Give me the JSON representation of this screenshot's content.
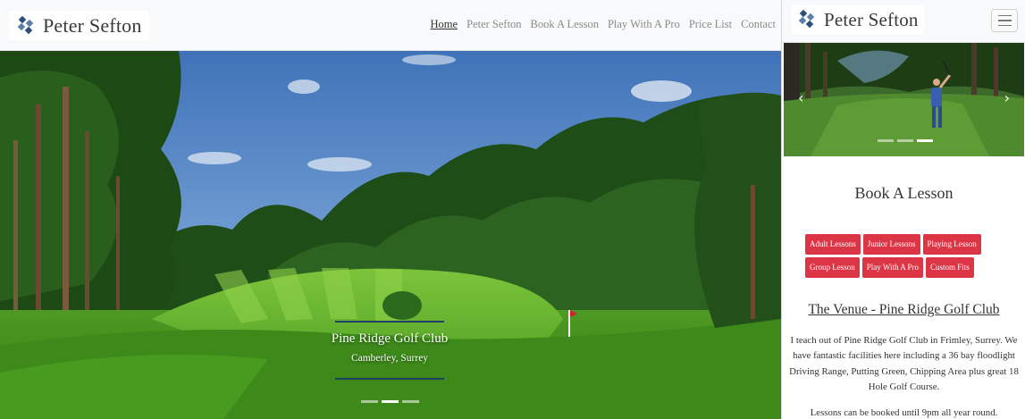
{
  "desktop": {
    "brand": {
      "name": "Peter Sefton",
      "logo": "diamond-logo"
    },
    "nav": [
      {
        "label": "Home",
        "active": true
      },
      {
        "label": "Peter Sefton",
        "active": false
      },
      {
        "label": "Book A Lesson",
        "active": false
      },
      {
        "label": "Play With A Pro",
        "active": false
      },
      {
        "label": "Price List",
        "active": false
      },
      {
        "label": "Contact",
        "active": false
      }
    ],
    "hero": {
      "caption_title": "Pine Ridge Golf Club",
      "caption_sub": "Camberley, Surrey",
      "slide_count": 3,
      "active_slide": 2
    }
  },
  "mobile": {
    "brand": {
      "name": "Peter Sefton"
    },
    "menu_icon": "hamburger-icon",
    "hero": {
      "slide_count": 3,
      "active_slide": 3,
      "prev_icon": "chevron-left-icon",
      "next_icon": "chevron-right-icon"
    },
    "section_title": "Book A Lesson",
    "buttons": [
      "Adult Lessons",
      "Junior Lessons",
      "Playing Lesson",
      "Group Lesson",
      "Play With A Pro",
      "Custom Fits"
    ],
    "venue_title": "The Venue - Pine Ridge Golf Club",
    "venue_text": "I teach out of Pine Ridge Golf Club in Frimley, Surrey. We have fantastic facilities here including a 36 bay floodlight Driving Range, Putting Green, Chipping Area plus great 18 Hole Golf Course.",
    "venue_text2": "Lessons can be booked until 9pm all year round."
  },
  "colors": {
    "button_red": "#dc3545",
    "caption_rule": "#1f3f66",
    "logo_blue": "#2c4f7a",
    "navbar_bg": "#f8f9fa"
  }
}
